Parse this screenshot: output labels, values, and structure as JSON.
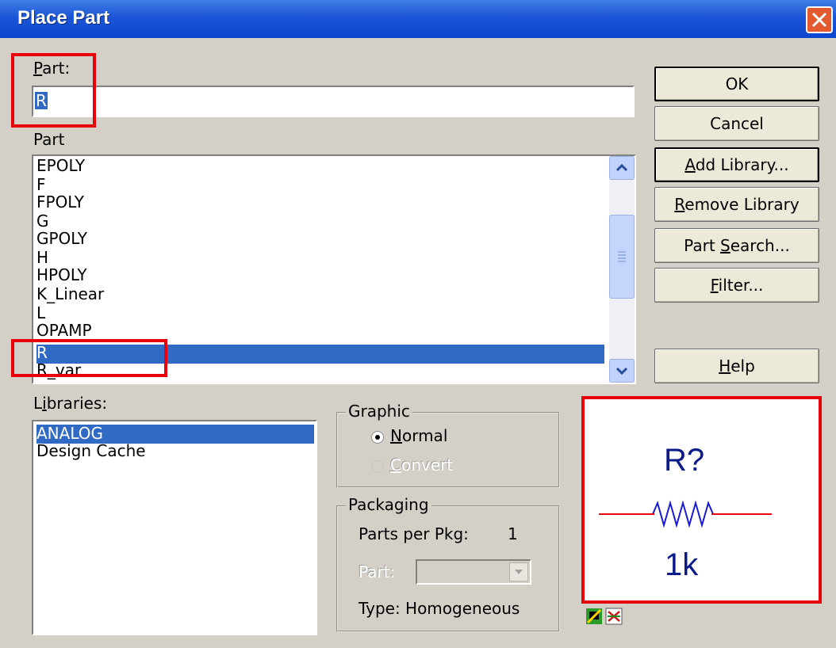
{
  "window": {
    "title": "Place Part"
  },
  "part_field": {
    "label": "Part:",
    "label_accel": "P",
    "label_rest": "art:",
    "value": "R"
  },
  "part_list": {
    "heading": "Part",
    "items": [
      "EPOLY",
      "F",
      "FPOLY",
      "G",
      "GPOLY",
      "H",
      "HPOLY",
      "K_Linear",
      "L",
      "OPAMP",
      "R",
      "R_var"
    ],
    "selected": "R"
  },
  "libraries": {
    "label_pre": "L",
    "label_accel": "i",
    "label_post": "braries:",
    "items": [
      "ANALOG",
      "Design Cache"
    ],
    "selected": "ANALOG"
  },
  "buttons": {
    "ok": "OK",
    "cancel": "Cancel",
    "add_library": {
      "accel": "A",
      "rest": "dd Library..."
    },
    "remove_library": {
      "accel": "R",
      "rest": "emove Library"
    },
    "part_search": {
      "pre": "Part ",
      "accel": "S",
      "rest": "earch..."
    },
    "filter": {
      "accel": "F",
      "rest": "ilter..."
    },
    "help": {
      "accel": "H",
      "rest": "elp"
    }
  },
  "graphic": {
    "legend": "Graphic",
    "normal": {
      "accel": "N",
      "rest": "ormal",
      "checked": true
    },
    "convert": {
      "accel": "C",
      "rest": "onvert",
      "enabled": false
    }
  },
  "packaging": {
    "legend": "Packaging",
    "parts_per_pkg_label": "Parts per Pkg:",
    "parts_per_pkg_value": "1",
    "part_label": "Part:",
    "type_label": "Type: Homogeneous"
  },
  "preview": {
    "reference": "R?",
    "value": "1k",
    "wire_color": "#e8000a",
    "symbol_color": "#1a1ad0",
    "text_color": "#0a1a8a"
  },
  "colors": {
    "highlight_box": "#e8000a",
    "selection": "#316ac5",
    "title_bar": "#0a47cf"
  }
}
